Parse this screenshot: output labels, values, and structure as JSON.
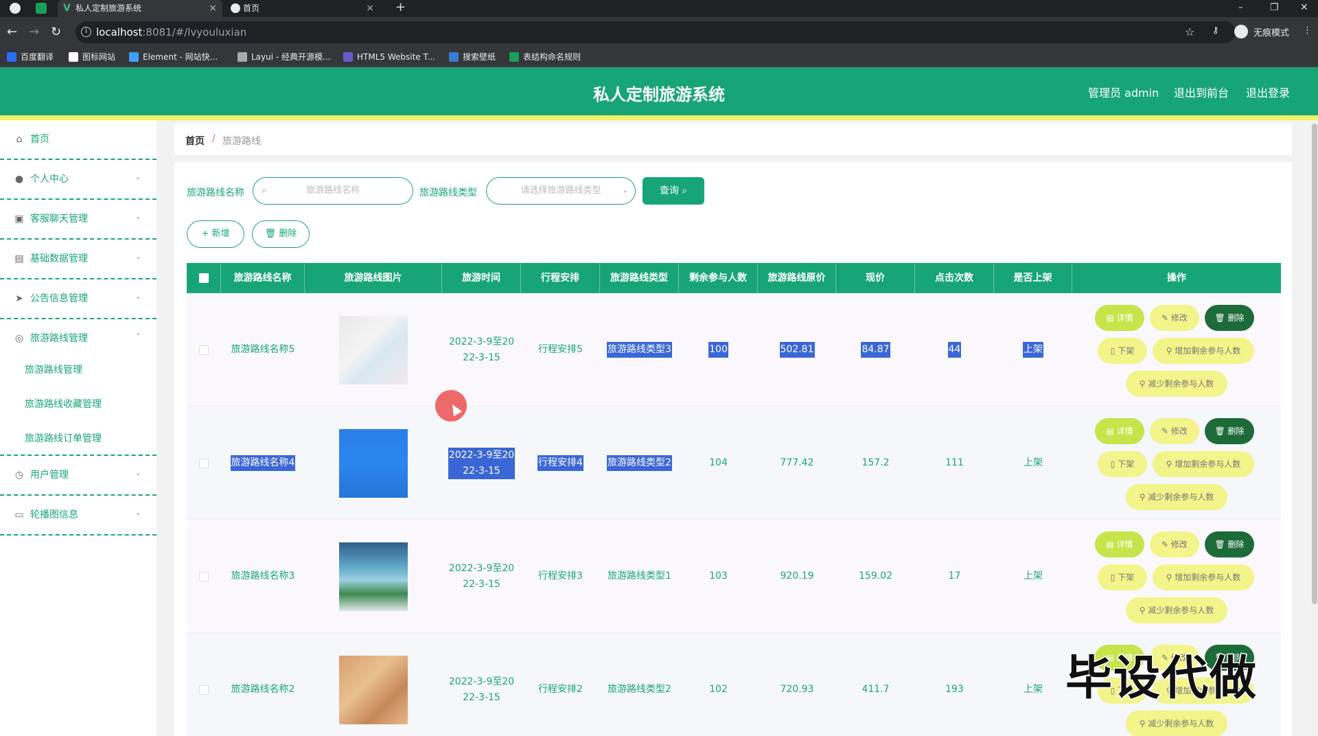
{
  "browser": {
    "tabs": [
      {
        "title": "私人定制旅游系统",
        "active": true
      },
      {
        "title": "首页",
        "active": false
      }
    ],
    "url_host": "localhost",
    "url_path": ":8081/#/lvyouluxian",
    "incognito": "无痕模式",
    "bookmarks": [
      "百度翻译",
      "图标网站",
      "Element - 网站快...",
      "Layui - 经典开源模...",
      "HTML5 Website T...",
      "搜索壁纸",
      "表结构命名规则"
    ]
  },
  "header": {
    "title": "私人定制旅游系统",
    "admin": "管理员 admin",
    "to_front": "退出到前台",
    "logout": "退出登录",
    "brand_color": "#17a577"
  },
  "sidebar": {
    "items": [
      {
        "label": "首页",
        "icon": "home-icon"
      },
      {
        "label": "个人中心",
        "icon": "user-icon"
      },
      {
        "label": "客服聊天管理",
        "icon": "chat-icon"
      },
      {
        "label": "基础数据管理",
        "icon": "database-icon"
      },
      {
        "label": "公告信息管理",
        "icon": "send-icon"
      },
      {
        "label": "旅游路线管理",
        "icon": "route-icon"
      },
      {
        "label": "用户管理",
        "icon": "users-icon"
      },
      {
        "label": "轮播图信息",
        "icon": "image-icon"
      }
    ],
    "sub_items": [
      "旅游路线管理",
      "旅游路线收藏管理",
      "旅游路线订单管理"
    ]
  },
  "breadcrumb": {
    "home": "首页",
    "current": "旅游路线"
  },
  "filters": {
    "name_label": "旅游路线名称",
    "name_placeholder": "旅游路线名称",
    "type_label": "旅游路线类型",
    "type_placeholder": "请选择旅游路线类型",
    "query": "查询",
    "add": "+ 新增",
    "delete": "删除"
  },
  "table": {
    "headers": [
      "旅游路线名称",
      "旅游路线图片",
      "旅游时间",
      "行程安排",
      "旅游路线类型",
      "剩余参与人数",
      "旅游路线原价",
      "现价",
      "点击次数",
      "是否上架",
      "操作"
    ],
    "rows": [
      {
        "name": "旅游路线名称5",
        "time1": "2022-3-9至20",
        "time2": "22-3-15",
        "plan": "行程安排5",
        "type": "旅游路线类型3",
        "remain": "100",
        "orig": "502.81",
        "price": "84.87",
        "clicks": "44",
        "status": "上架"
      },
      {
        "name": "旅游路线名称4",
        "time1": "2022-3-9至20",
        "time2": "22-3-15",
        "plan": "行程安排4",
        "type": "旅游路线类型2",
        "remain": "104",
        "orig": "777.42",
        "price": "157.2",
        "clicks": "111",
        "status": "上架"
      },
      {
        "name": "旅游路线名称3",
        "time1": "2022-3-9至20",
        "time2": "22-3-15",
        "plan": "行程安排3",
        "type": "旅游路线类型1",
        "remain": "103",
        "orig": "920.19",
        "price": "159.02",
        "clicks": "17",
        "status": "上架"
      },
      {
        "name": "旅游路线名称2",
        "time1": "2022-3-9至20",
        "time2": "22-3-15",
        "plan": "行程安排2",
        "type": "旅游路线类型2",
        "remain": "102",
        "orig": "720.93",
        "price": "411.7",
        "clicks": "193",
        "status": "上架"
      }
    ],
    "actions": {
      "detail": "详情",
      "edit": "修改",
      "delete": "删除",
      "offshelf": "下架",
      "increase": "增加剩余参与人数",
      "decrease": "减少剩余参与人数"
    }
  },
  "watermark": "毕设代做"
}
